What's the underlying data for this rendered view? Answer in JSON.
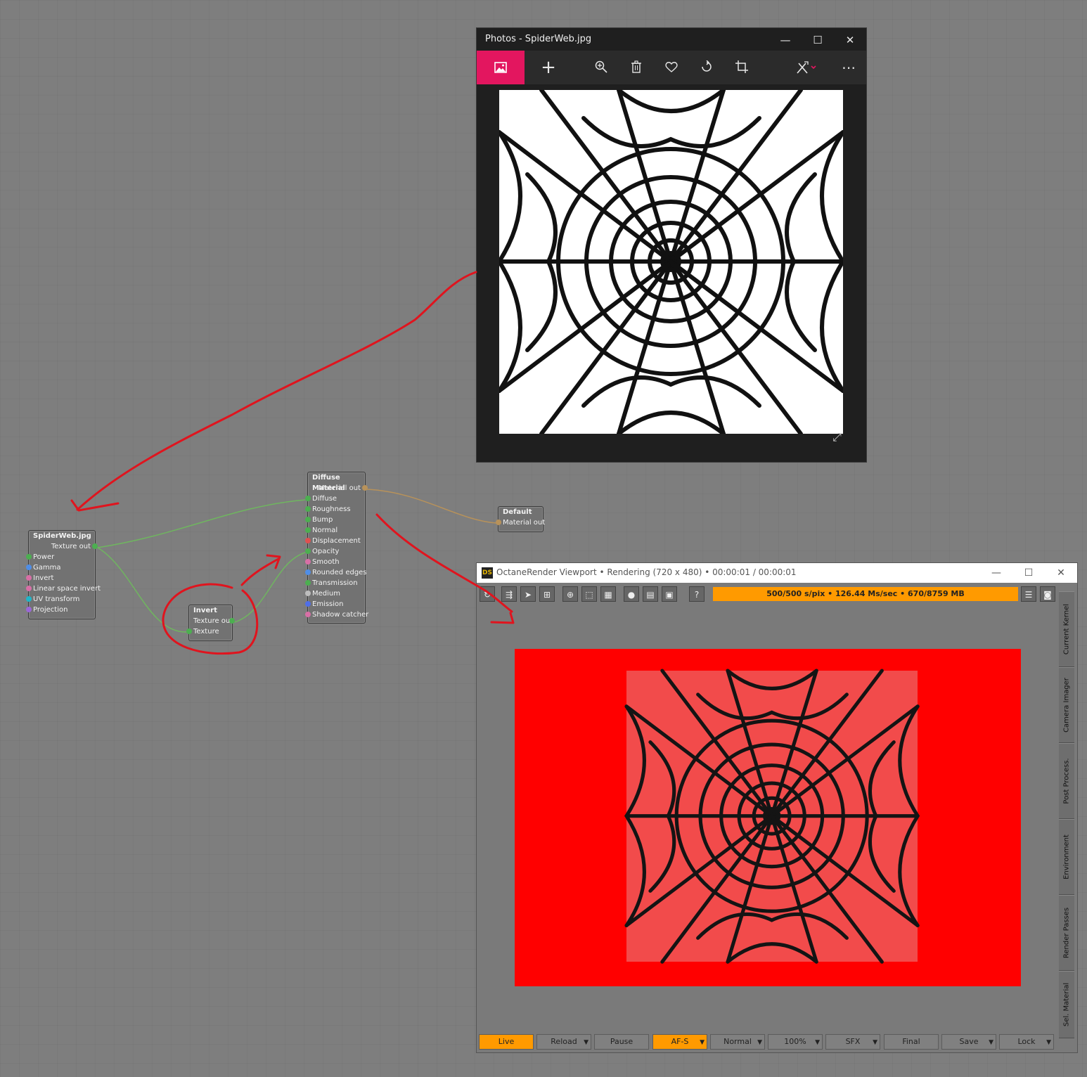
{
  "photos": {
    "title": "Photos - SpiderWeb.jpg",
    "controls": {
      "minimize": "—",
      "maximize": "☐",
      "close": "✕"
    },
    "toolbar": {
      "add": "+",
      "more": "⋯"
    }
  },
  "nodes": {
    "spiderweb": {
      "title": "SpiderWeb.jpg",
      "output": "Texture out",
      "inputs": [
        "Power",
        "Gamma",
        "Invert",
        "Linear space invert",
        "UV transform",
        "Projection"
      ]
    },
    "invert": {
      "title": "Invert",
      "output": "Texture out",
      "inputs": [
        "Texture"
      ]
    },
    "diffuse": {
      "title": "Diffuse Material",
      "output": "Material out",
      "inputs": [
        "Diffuse",
        "Roughness",
        "Bump",
        "Normal",
        "Displacement",
        "Opacity",
        "Smooth",
        "Rounded edges",
        "Transmission",
        "Medium",
        "Emission",
        "Shadow catcher"
      ]
    },
    "default": {
      "title": "Default",
      "output": "Material out"
    }
  },
  "octane": {
    "logo": "DS",
    "title": "OctaneRender Viewport • Rendering (720 x 480) • 00:00:01 / 00:00:01",
    "controls": {
      "minimize": "—",
      "maximize": "☐",
      "close": "✕"
    },
    "status": "500/500 s/pix • 126.44 Ms/sec • 670/8759 MB",
    "side_tabs": [
      "Current Kernel",
      "Camera Imager",
      "Post Process.",
      "Environment",
      "Render Passes",
      "Sel. Material"
    ],
    "buttons": [
      "Live",
      "Reload",
      "Pause",
      "AF-S",
      "Normal",
      "100%",
      "SFX",
      "Final",
      "Save",
      "Lock"
    ],
    "help": "?"
  },
  "colors": {
    "accent_pink": "#e3165f",
    "status_orange": "#ff9a00",
    "render_red": "#ff0000",
    "annotation_red": "#e0141e",
    "pin_green": "#4caf50",
    "pin_blue": "#4f8ee8",
    "pin_pink": "#d86fa6",
    "pin_cyan": "#1fb6c9",
    "pin_purple": "#9b67d8"
  }
}
